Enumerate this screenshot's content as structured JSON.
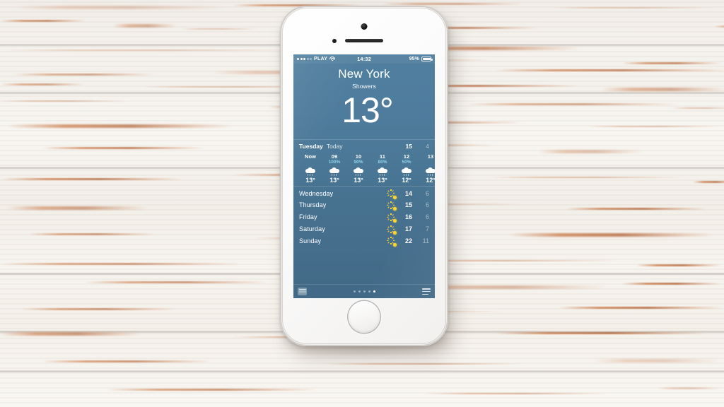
{
  "device": {
    "name": "iPhone 5s",
    "color": "silver-white",
    "home_button": "home-button",
    "camera": "front-camera",
    "earpiece": "earpiece-speaker"
  },
  "background": {
    "surface": "whitewashed distressed wood planks",
    "base_color": "#f5f2ed",
    "accent_color": "#c46830"
  },
  "status_bar": {
    "carrier": "PLAY",
    "signal_dots_filled": 3,
    "signal_dots_total": 5,
    "wifi": "wifi-icon",
    "time": "14:32",
    "battery_pct": "95%"
  },
  "weather": {
    "city": "New York",
    "condition": "Showers",
    "current_temp": "13°",
    "summary": {
      "day": "Tuesday",
      "today_label": "Today",
      "high": "15",
      "low": "4"
    },
    "hourly": [
      {
        "label": "Now",
        "pop": "",
        "icon": "cloud-rain-icon",
        "temp": "13°"
      },
      {
        "label": "09",
        "pop": "100%",
        "icon": "cloud-rain-icon",
        "temp": "13°"
      },
      {
        "label": "10",
        "pop": "90%",
        "icon": "cloud-rain-icon",
        "temp": "13°"
      },
      {
        "label": "11",
        "pop": "80%",
        "icon": "cloud-rain-icon",
        "temp": "13°"
      },
      {
        "label": "12",
        "pop": "50%",
        "icon": "cloud-rain-icon",
        "temp": "12°"
      },
      {
        "label": "13",
        "pop": "",
        "icon": "cloud-rain-icon",
        "temp": "12°"
      }
    ],
    "daily": [
      {
        "day": "Wednesday",
        "icon": "sun-icon",
        "high": "14",
        "low": "6"
      },
      {
        "day": "Thursday",
        "icon": "sun-icon",
        "high": "15",
        "low": "6"
      },
      {
        "day": "Friday",
        "icon": "sun-icon",
        "high": "16",
        "low": "6"
      },
      {
        "day": "Saturday",
        "icon": "sun-icon",
        "high": "17",
        "low": "7"
      },
      {
        "day": "Sunday",
        "icon": "sun-icon",
        "high": "22",
        "low": "11"
      }
    ],
    "footer": {
      "brand_logo": "weather-channel-logo",
      "page_count": 5,
      "page_active_index": 4,
      "list_button": "city-list-icon"
    },
    "colors": {
      "sky_top": "#507f9f",
      "sky_bottom": "#426a87",
      "pop_text": "#8fd3e8",
      "sun": "#ffd52e"
    }
  }
}
